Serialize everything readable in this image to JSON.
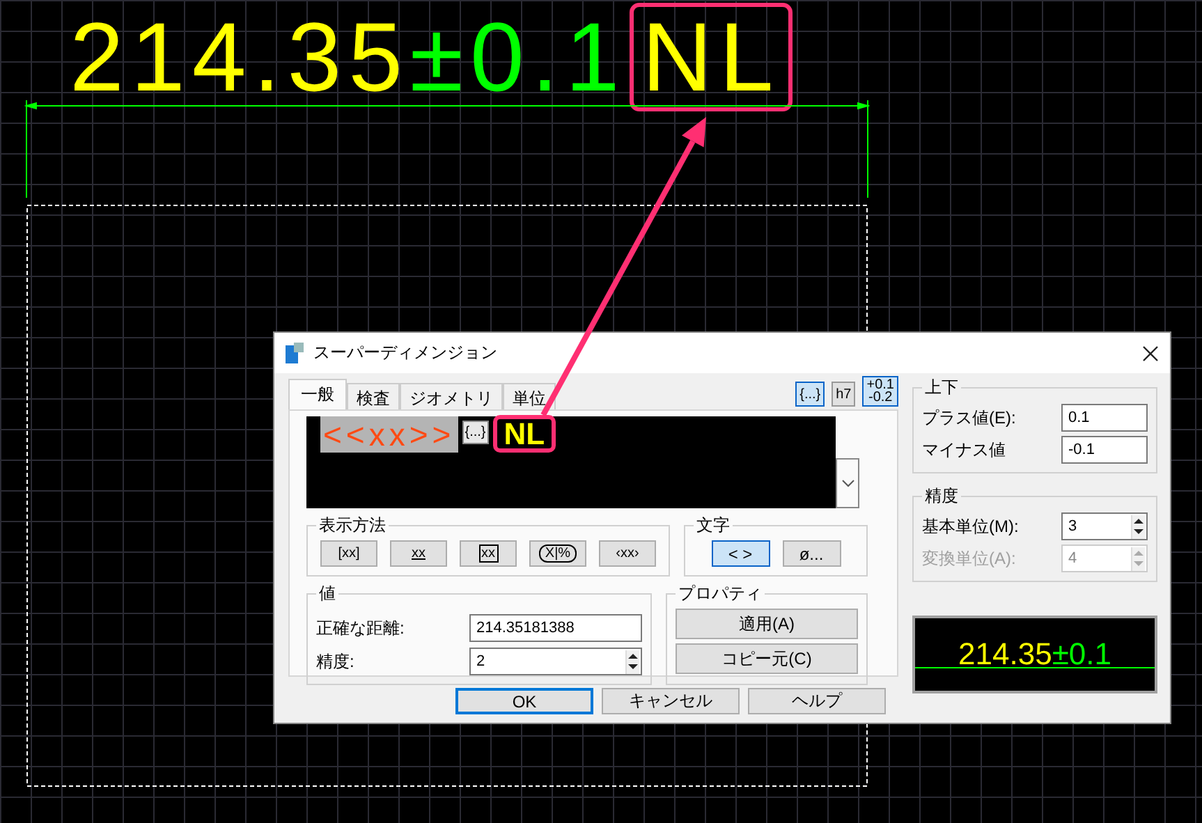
{
  "canvas": {
    "dimension": {
      "value": "214.35",
      "tolerance": "±0.1",
      "suffix": "NL"
    }
  },
  "dialog": {
    "title": "スーパーディメンジョン",
    "tabs": [
      {
        "label": "一般",
        "selected": true
      },
      {
        "label": "検査",
        "selected": false
      },
      {
        "label": "ジオメトリ",
        "selected": false
      },
      {
        "label": "単位",
        "selected": false
      }
    ],
    "format_buttons": [
      {
        "label": "{...}",
        "selected": true
      },
      {
        "label": "h7",
        "selected": false
      },
      {
        "label": "+0.1\n-0.2",
        "selected": true
      }
    ],
    "editor": {
      "measurement": "<<xx>>",
      "field": "{...}",
      "text": "NL"
    },
    "display_method": {
      "title": "表示方法",
      "buttons": [
        {
          "kind": "bracket",
          "label": "[xx]"
        },
        {
          "kind": "underline",
          "label": "xx"
        },
        {
          "kind": "boxed",
          "label": "xx"
        },
        {
          "kind": "pill",
          "label": "X|%"
        },
        {
          "kind": "angle",
          "label": "‹xx›"
        }
      ]
    },
    "text_group": {
      "title": "文字",
      "buttons": [
        {
          "label": "< >",
          "selected": true
        },
        {
          "label": "ø...",
          "selected": false
        }
      ]
    },
    "value_group": {
      "title": "値",
      "fields": [
        {
          "kind": "text",
          "label": "正確な距離:",
          "value": "214.35181388"
        },
        {
          "kind": "spin",
          "label": "精度:",
          "value": "2"
        }
      ]
    },
    "properties": {
      "title": "プロパティ",
      "buttons": [
        "適用(A)",
        "コピー元(C)"
      ]
    },
    "footer_buttons": [
      {
        "label": "OK",
        "default": true
      },
      {
        "label": "キャンセル",
        "default": false
      },
      {
        "label": "ヘルプ",
        "default": false
      }
    ],
    "tolerance": {
      "title": "上下",
      "fields": [
        {
          "label": "プラス値(E):",
          "value": "0.1"
        },
        {
          "label": "マイナス値",
          "value": "-0.1"
        }
      ]
    },
    "precision": {
      "title": "精度",
      "fields": [
        {
          "label": "基本単位(M):",
          "value": "3",
          "disabled": false
        },
        {
          "label": "変換単位(A):",
          "value": "4",
          "disabled": true
        }
      ]
    },
    "preview": {
      "value": "214.35",
      "tolerance": "±0.1"
    }
  }
}
